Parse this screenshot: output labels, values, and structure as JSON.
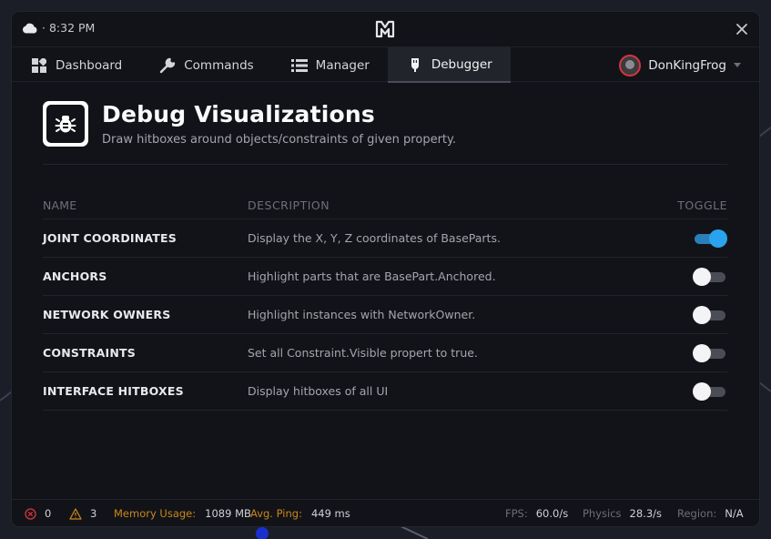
{
  "titlebar": {
    "time": "· 8:32 PM",
    "weather_icon": "cloud-icon",
    "logo_icon": "app-logo",
    "close_icon": "close-icon"
  },
  "nav": {
    "tabs": [
      {
        "label": "Dashboard",
        "icon": "grid-icon"
      },
      {
        "label": "Commands",
        "icon": "wrench-icon"
      },
      {
        "label": "Manager",
        "icon": "list-icon"
      },
      {
        "label": "Debugger",
        "icon": "plug-icon",
        "active": true
      }
    ],
    "user": {
      "name": "DonKingFrog"
    }
  },
  "header": {
    "title": "Debug Visualizations",
    "subtitle": "Draw hitboxes around objects/constraints of given property."
  },
  "table": {
    "columns": {
      "name": "NAME",
      "description": "DESCRIPTION",
      "toggle": "TOGGLE"
    },
    "rows": [
      {
        "name": "JOINT COORDINATES",
        "description": "Display the X, Y, Z coordinates of BaseParts.",
        "enabled": true
      },
      {
        "name": "ANCHORS",
        "description": "Highlight parts that are BasePart.Anchored.",
        "enabled": false
      },
      {
        "name": "NETWORK OWNERS",
        "description": "Highlight instances with NetworkOwner.",
        "enabled": false
      },
      {
        "name": "CONSTRAINTS",
        "description": "Set all Constraint.Visible propert to true.",
        "enabled": false
      },
      {
        "name": "INTERFACE HITBOXES",
        "description": "Display hitboxes of all UI",
        "enabled": false
      }
    ]
  },
  "status": {
    "errors": "0",
    "warnings": "3",
    "memory_label": "Memory Usage:",
    "memory_value": "1089 MB",
    "ping_label": "Avg. Ping:",
    "ping_value": "449 ms",
    "fps_label": "FPS:",
    "fps_value": "60.0/s",
    "physics_label": "Physics",
    "physics_value": "28.3/s",
    "region_label": "Region:",
    "region_value": "N/A"
  },
  "colors": {
    "accent": "#2aa3ee",
    "warning": "#c9861a",
    "error": "#d8353e",
    "window_bg": "#121318"
  }
}
